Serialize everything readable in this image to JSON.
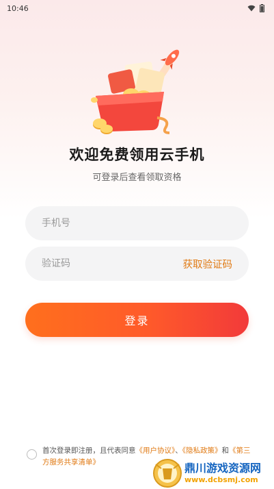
{
  "status_bar": {
    "time": "10:46"
  },
  "header": {
    "title": "欢迎免费领用云手机",
    "subtitle": "可登录后查看领取资格"
  },
  "form": {
    "phone_placeholder": "手机号",
    "code_placeholder": "验证码",
    "get_code_label": "获取验证码",
    "login_label": "登录"
  },
  "agreement": {
    "prefix": "首次登录即注册，且代表同意",
    "link_user": "《用户协议》",
    "sep1": "、",
    "link_privacy": "《隐私政策》",
    "and": "和",
    "link_third": "《第三方服务共享清单》",
    "suffix": ""
  },
  "watermark": {
    "main": "鼎川游戏资源网",
    "url": "www.dcbsmj.com"
  },
  "colors": {
    "accent": "#e07a14",
    "button_start": "#ff6f1d",
    "button_end": "#f23a3a"
  }
}
